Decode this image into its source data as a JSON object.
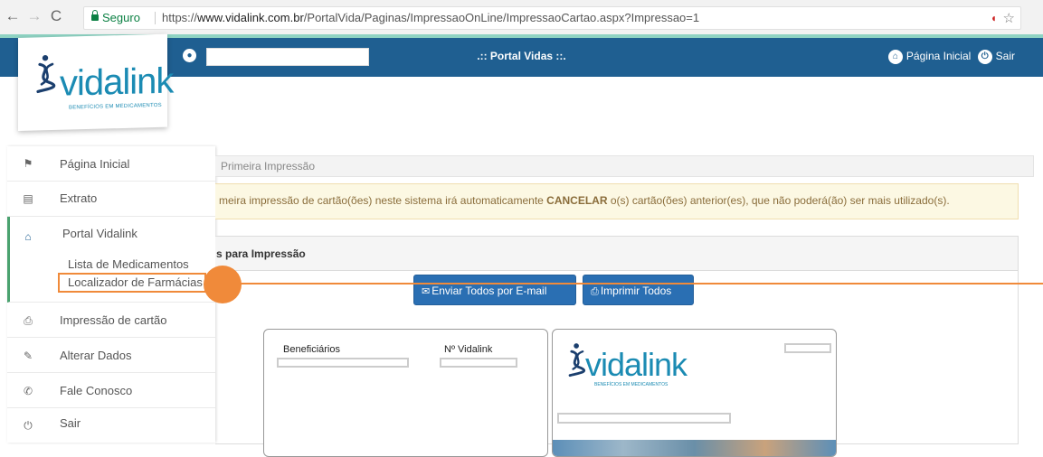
{
  "browser": {
    "secure_label": "Seguro",
    "url_prefix": "https://",
    "url_domain": "www.vidalink.com.br",
    "url_path": "/PortalVida/Paginas/ImpressaoOnLine/ImpressaoCartao.aspx?Impressao=1",
    "icons": [
      "back-icon",
      "forward-icon",
      "reload-icon",
      "lock-icon",
      "extension-icon",
      "star-icon"
    ]
  },
  "header": {
    "portal_title": ".:: Portal Vidas ::.",
    "home_link": "Página Inicial",
    "logout_link": "Sair",
    "bar_color": "#1f5f91"
  },
  "logo": {
    "name": "vidalink",
    "tagline": "BENEFÍCIOS EM MEDICAMENTOS",
    "color": "#1b8bb3"
  },
  "sidebar": {
    "items": [
      {
        "label": "Página Inicial",
        "icon": "flag-icon"
      },
      {
        "label": "Extrato",
        "icon": "document-icon"
      },
      {
        "label": "Portal Vidalink",
        "icon": "home-icon"
      },
      {
        "label": "Impressão de cartão",
        "icon": "printer-icon"
      },
      {
        "label": "Alterar Dados",
        "icon": "user-edit-icon"
      },
      {
        "label": "Fale Conosco",
        "icon": "phone-icon"
      },
      {
        "label": "Sair",
        "icon": "power-icon"
      }
    ],
    "sub_items": [
      "Lista de Medicamentos",
      "Localizador de Farmácias"
    ]
  },
  "main": {
    "breadcrumb": "Primeira Impressão",
    "alert_pre": "meira impressão de cartão(ões) neste sistema irá automaticamente ",
    "alert_strong": "CANCELAR",
    "alert_post": " o(s) cartão(ões) anterior(es), que não poderá(ão) ser mais utilizado(s).",
    "panel_title": "s para Impressão",
    "email_button": "Enviar Todos por E-mail",
    "print_button": "Imprimir Todos",
    "col_beneficiarios": "Beneficiários",
    "col_vidalink": "Nº Vidalink"
  },
  "annotation": {
    "color": "#f08a3a"
  }
}
